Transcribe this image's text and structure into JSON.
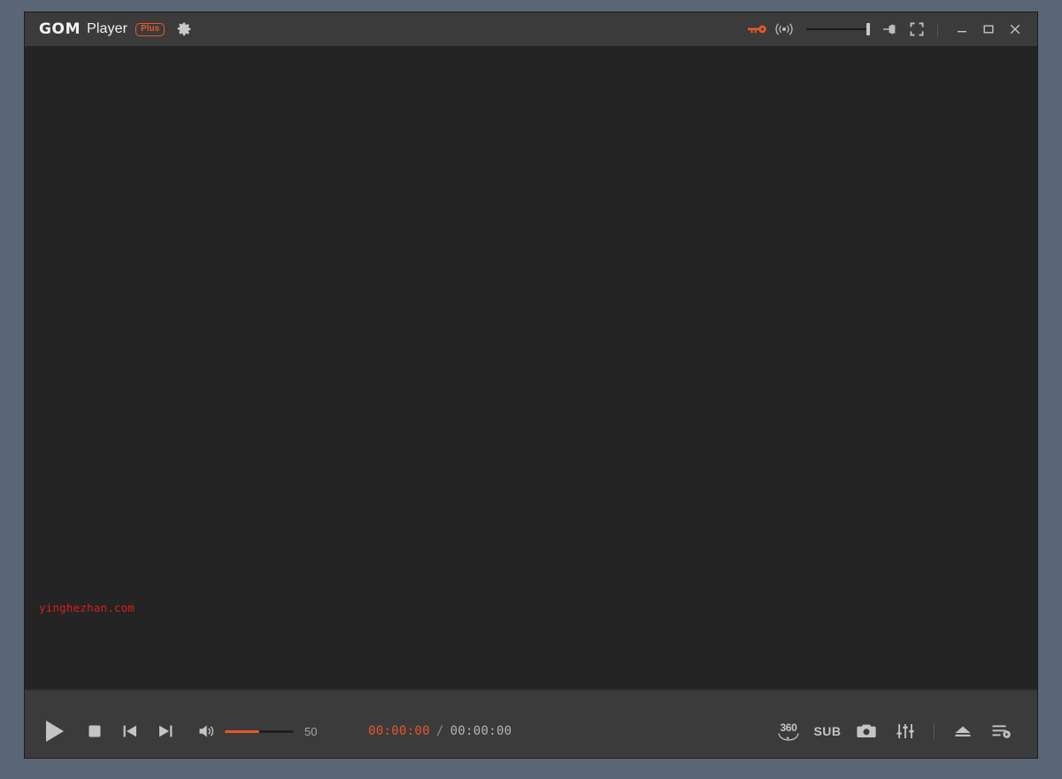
{
  "app": {
    "brand_gom": "GOM",
    "brand_player": "Player",
    "brand_badge": "Plus",
    "accent_color": "#e8562a",
    "titlebar_bg": "#3b3b3b",
    "video_bg": "#242424",
    "desktop_bg": "#5a6676"
  },
  "titlebar": {
    "settings_icon": "gear-icon",
    "license_icon": "key-icon",
    "broadcast_icon": "broadcast-icon",
    "brightness_slider_icon": "brightness-slider",
    "pin_icon": "pin-icon",
    "fullscreen_icon": "fullscreen-icon",
    "minimize_icon": "minimize-icon",
    "maximize_icon": "maximize-icon",
    "close_icon": "close-icon"
  },
  "video": {
    "watermark": "yinghezhan.com",
    "watermark_color": "#d81f1f"
  },
  "seek": {
    "progress_percent": 0
  },
  "controls": {
    "play_icon": "play-icon",
    "stop_icon": "stop-icon",
    "previous_icon": "previous-track-icon",
    "next_icon": "next-track-icon",
    "volume_icon": "volume-icon",
    "volume_value": "50",
    "volume_percent": 50,
    "time_current": "00:00:00",
    "time_separator": "/",
    "time_total": "00:00:00",
    "vr360_label": "360",
    "vr360_icon": "vr-360-icon",
    "subtitle_label": "SUB",
    "screenshot_icon": "camera-icon",
    "equalizer_icon": "equalizer-icon",
    "eject_icon": "eject-icon",
    "playlist_icon": "playlist-icon"
  }
}
